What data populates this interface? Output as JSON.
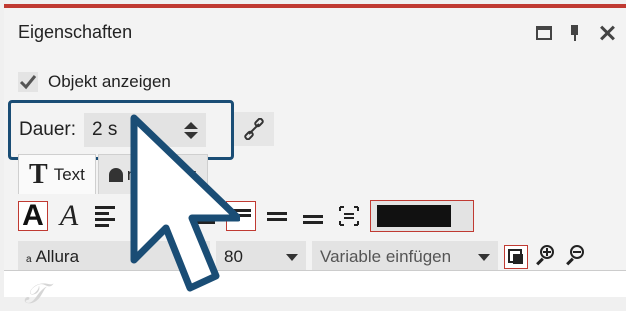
{
  "panel": {
    "title": "Eigenschaften",
    "accent_color": "#c03a32",
    "highlight_color": "#1a4d75"
  },
  "window_controls": [
    "maximize-icon",
    "pin-icon",
    "close-icon"
  ],
  "show_object": {
    "label": "Objekt anzeigen",
    "checked": true
  },
  "duration": {
    "label": "Dauer:",
    "value": "2 s"
  },
  "tabs": [
    {
      "label": "Text",
      "active": true
    },
    {
      "label": "nsparenz",
      "active": false
    }
  ],
  "text_toolbar": {
    "bold_glyph": "A",
    "italic_glyph": "A",
    "text_color": "#111111"
  },
  "font": {
    "name": "Allura",
    "size": "80",
    "variable_placeholder": "Variable einfügen"
  }
}
